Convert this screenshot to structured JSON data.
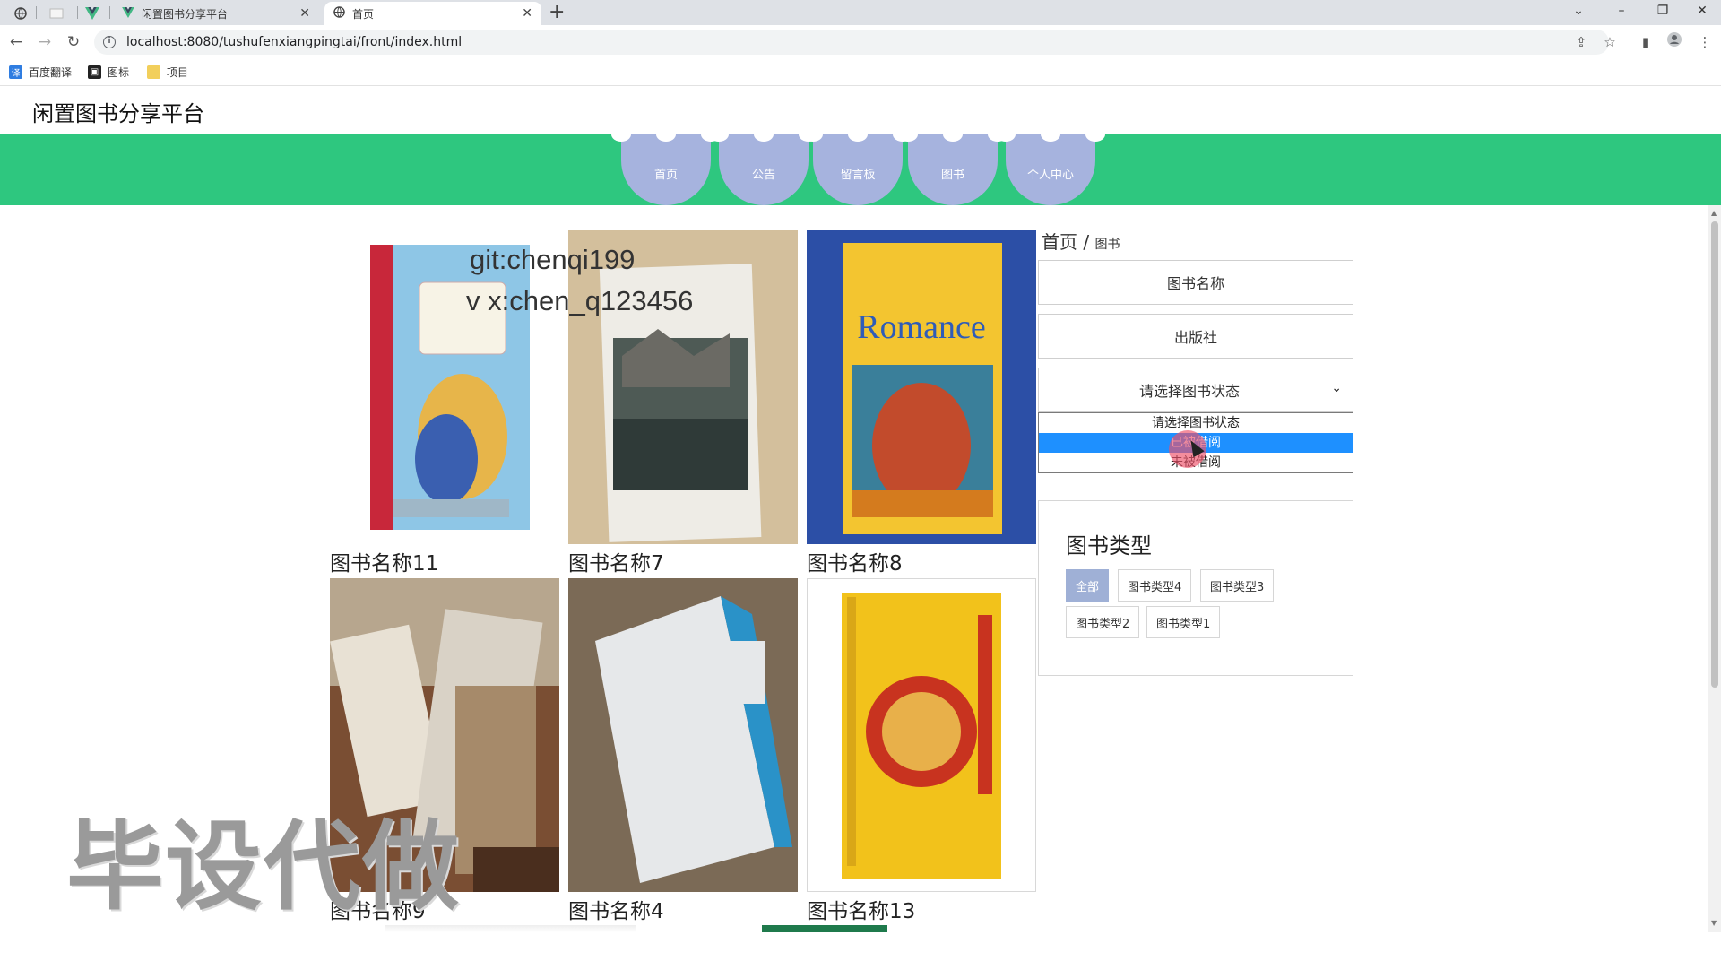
{
  "browser": {
    "tabs": [
      {
        "title": "闲置图书分享平台",
        "active": false
      },
      {
        "title": "首页",
        "active": true
      }
    ],
    "url": "localhost:8080/tushufenxiangpingtai/front/index.html",
    "bookmarks": [
      "百度翻译",
      "图标",
      "项目"
    ]
  },
  "site": {
    "title": "闲置图书分享平台"
  },
  "nav": {
    "items": [
      {
        "label": "首页"
      },
      {
        "label": "公告"
      },
      {
        "label": "留言板"
      },
      {
        "label": "图书"
      },
      {
        "label": "个人中心"
      }
    ]
  },
  "books": [
    {
      "name": "图书名称11",
      "cover_color": "#7ab7de"
    },
    {
      "name": "图书名称7",
      "cover_color": "#d8cfc1"
    },
    {
      "name": "图书名称8",
      "cover_color": "#2a4ea3"
    },
    {
      "name": "图书名称9",
      "cover_color": "#8a5a3c"
    },
    {
      "name": "图书名称4",
      "cover_color": "#6a5a48"
    },
    {
      "name": "图书名称13",
      "cover_color": "#f2c21b"
    }
  ],
  "sidebar": {
    "breadcrumb": {
      "home": "首页",
      "separator": "/",
      "current": "图书"
    },
    "search_name_placeholder": "图书名称",
    "search_publisher_placeholder": "出版社",
    "status_select": {
      "value": "请选择图书状态",
      "options": [
        "请选择图书状态",
        "已被借阅",
        "未被借阅"
      ],
      "highlighted_index": 1
    },
    "types": {
      "title": "图书类型",
      "items": [
        "全部",
        "图书类型4",
        "图书类型3",
        "图书类型2",
        "图书类型1"
      ],
      "selected": "全部"
    }
  },
  "watermarks": {
    "line1": "git:chenqi199",
    "line2": "v x:chen_q123456",
    "big": "毕设代做"
  },
  "colors": {
    "nav_bar": "#2ec77f",
    "nav_item": "#a6b3de",
    "dropdown_highlight": "#1e90ff",
    "chip_selected": "#9fb0d6"
  }
}
